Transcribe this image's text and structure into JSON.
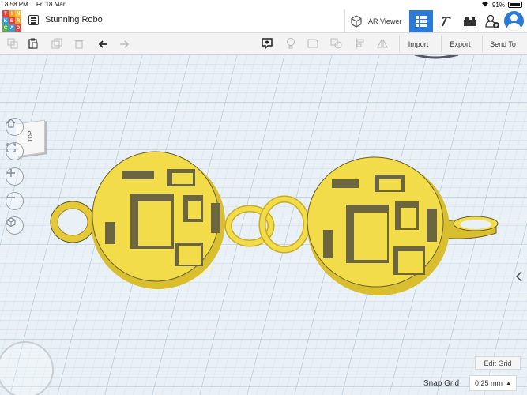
{
  "status_bar": {
    "time": "8:58 PM",
    "date": "Fri 18 Mar",
    "battery": "91%"
  },
  "header": {
    "logo_letters": [
      "T",
      "I",
      "N",
      "K",
      "E",
      "R",
      "C",
      "A",
      "D"
    ],
    "logo_colors": [
      "#e8413c",
      "#f29d38",
      "#f8c13a",
      "#3a9ae0",
      "#e8413c",
      "#f29d38",
      "#4fb24f",
      "#3a9ae0",
      "#e8413c"
    ],
    "design_title": "Stunning Robo",
    "ar_viewer_label": "AR Viewer",
    "accent_color": "#2b7bd6"
  },
  "toolbar": {
    "icons": [
      "copy-icon",
      "paste-icon",
      "duplicate-icon",
      "delete-icon",
      "undo-icon",
      "redo-icon",
      "note-icon",
      "light-icon",
      "shape-icon",
      "group-icon",
      "align-icon",
      "mirror-icon"
    ],
    "import_label": "Import",
    "export_label": "Export",
    "send_to_label": "Send To"
  },
  "workplane": {
    "view_cube_label": "TOP",
    "grid_color": "#c8dcea",
    "model_color": "#f3dc4a",
    "nav_controls": [
      "home-view",
      "fit-view",
      "zoom-in",
      "zoom-out",
      "perspective"
    ]
  },
  "bottom": {
    "edit_grid_label": "Edit Grid",
    "snap_grid_label": "Snap Grid",
    "snap_grid_value": "0.25 mm"
  }
}
